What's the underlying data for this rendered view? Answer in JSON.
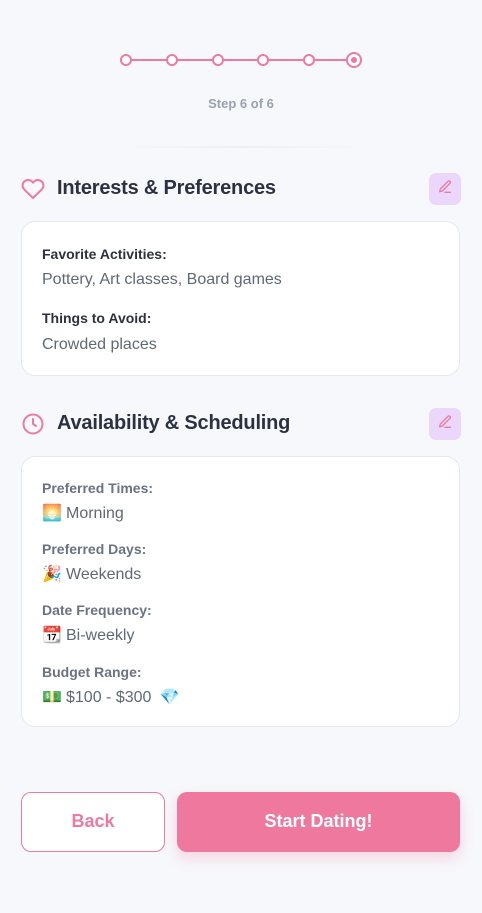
{
  "progress": {
    "current_step": 6,
    "total_steps": 6,
    "step_text": "Step 6 of 6"
  },
  "interests": {
    "title": "Interests & Preferences",
    "icon": "heart-icon",
    "favorite_label": "Favorite Activities:",
    "favorite_value": "Pottery, Art classes, Board games",
    "avoid_label": "Things to Avoid:",
    "avoid_value": "Crowded places"
  },
  "availability": {
    "title": "Availability & Scheduling",
    "icon": "clock-icon",
    "times_label": "Preferred Times:",
    "times_emoji": "🌅",
    "times_value": "Morning",
    "days_label": "Preferred Days:",
    "days_emoji": "🎉",
    "days_value": "Weekends",
    "frequency_label": "Date Frequency:",
    "frequency_emoji": "📆",
    "frequency_value": "Bi-weekly",
    "budget_label": "Budget Range:",
    "budget_emoji": "💵",
    "budget_value": "$100 - $300",
    "budget_tail_emoji": "💎"
  },
  "buttons": {
    "back": "Back",
    "start": "Start Dating!"
  },
  "colors": {
    "accent": "#ee7aa0",
    "edit_bg": "#ead7fb",
    "text": "#2b3140",
    "muted": "#5f6878"
  }
}
